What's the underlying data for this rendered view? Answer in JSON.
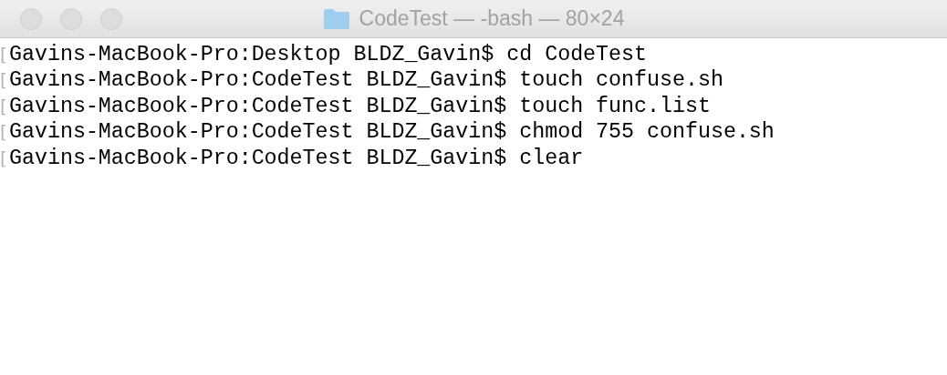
{
  "window": {
    "title": "CodeTest — -bash — 80×24"
  },
  "terminal": {
    "lines": [
      {
        "marker": "[",
        "text": "Gavins-MacBook-Pro:Desktop BLDZ_Gavin$ cd CodeTest"
      },
      {
        "marker": "[",
        "text": "Gavins-MacBook-Pro:CodeTest BLDZ_Gavin$ touch confuse.sh"
      },
      {
        "marker": "[",
        "text": "Gavins-MacBook-Pro:CodeTest BLDZ_Gavin$ touch func.list"
      },
      {
        "marker": "[",
        "text": "Gavins-MacBook-Pro:CodeTest BLDZ_Gavin$ chmod 755 confuse.sh"
      },
      {
        "marker": "[",
        "text": "Gavins-MacBook-Pro:CodeTest BLDZ_Gavin$ clear"
      }
    ]
  }
}
